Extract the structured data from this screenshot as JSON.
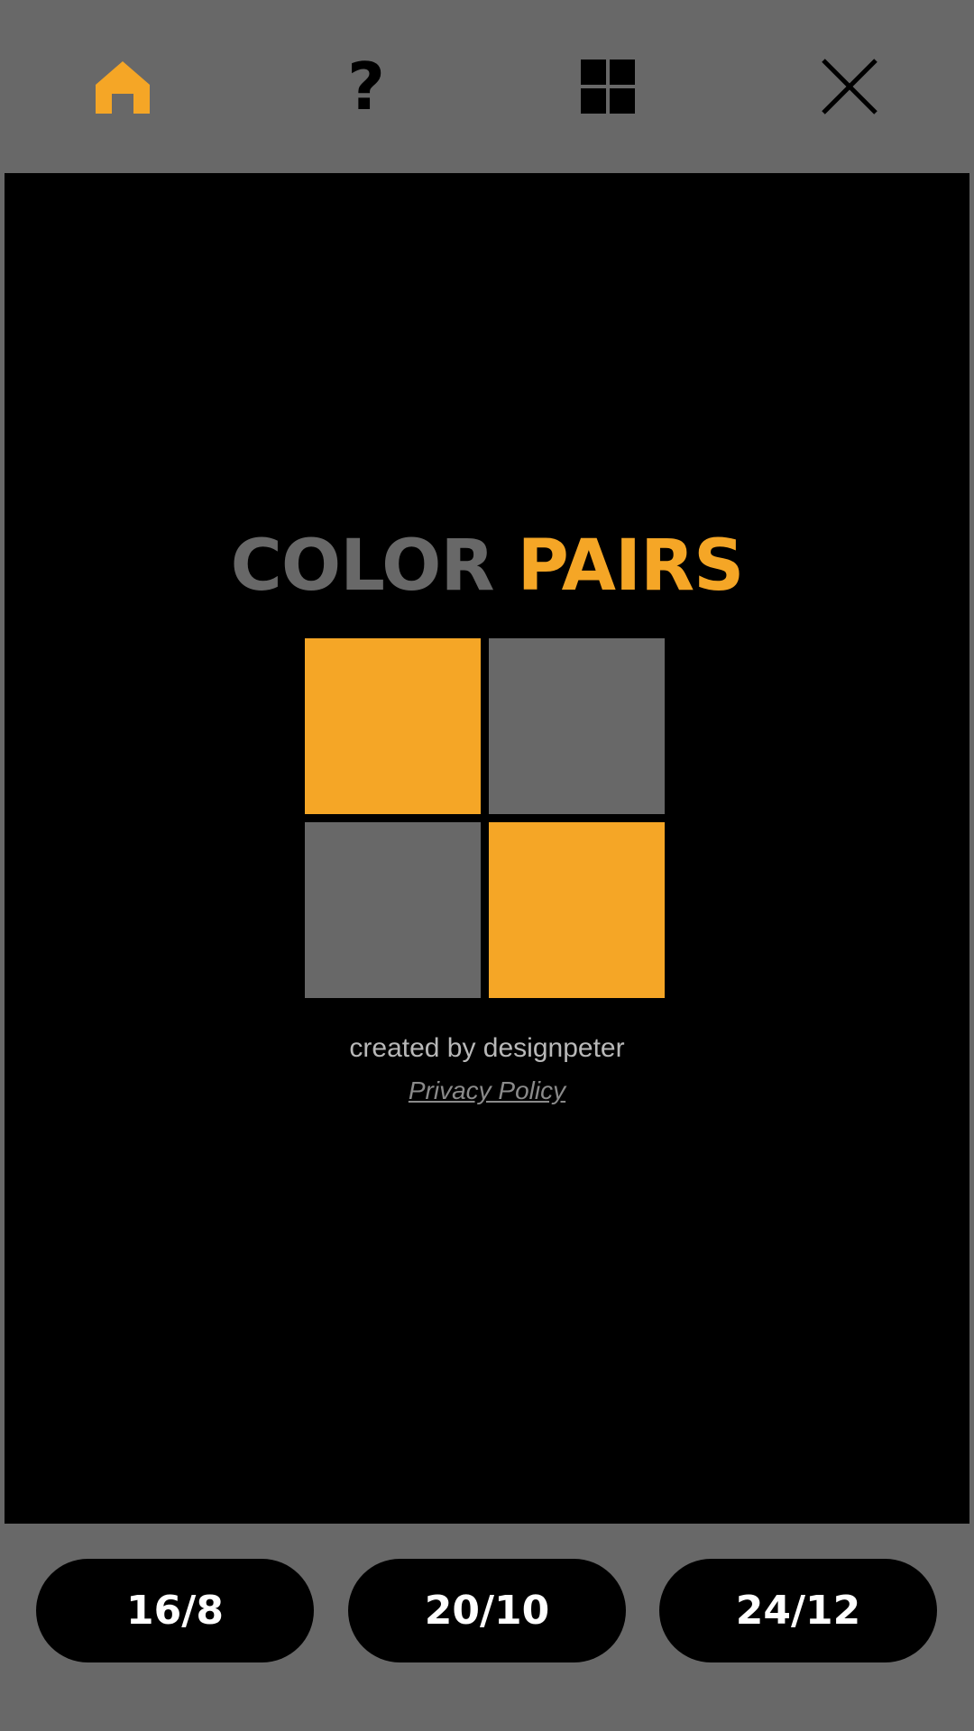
{
  "toolbar": {
    "icons": [
      "home-icon",
      "help-icon",
      "grid-icon",
      "close-icon"
    ],
    "help_glyph": "?"
  },
  "title": {
    "word1": "COLOR",
    "word2": "PAIRS"
  },
  "credit": "created by designpeter",
  "privacy_link": "Privacy Policy",
  "modes": [
    "16/8",
    "20/10",
    "24/12"
  ],
  "colors": {
    "background": "#686868",
    "stage": "#000000",
    "accent": "#f5a626",
    "gray": "#686868",
    "credit_text": "#b8b8b8",
    "link_text": "#8a8a8a"
  }
}
